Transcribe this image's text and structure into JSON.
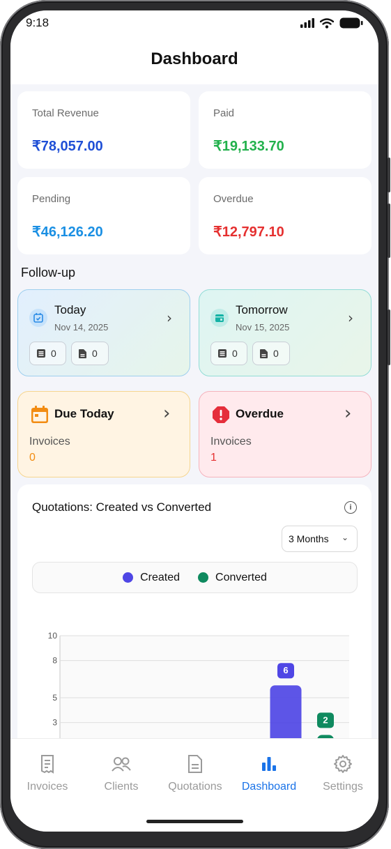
{
  "status_bar": {
    "time": "9:18"
  },
  "header": {
    "title": "Dashboard"
  },
  "stats": [
    {
      "label": "Total Revenue",
      "value": "₹78,057.00",
      "color": "#1f4fd6"
    },
    {
      "label": "Paid",
      "value": "₹19,133.70",
      "color": "#22b14c"
    },
    {
      "label": "Pending",
      "value": "₹46,126.20",
      "color": "#1a8fe3"
    },
    {
      "label": "Overdue",
      "value": "₹12,797.10",
      "color": "#e53030"
    }
  ],
  "followup": {
    "section_title": "Follow-up",
    "today": {
      "title": "Today",
      "date": "Nov 14, 2025",
      "invoices_count": "0",
      "quotations_count": "0"
    },
    "tomorrow": {
      "title": "Tomorrow",
      "date": "Nov 15, 2025",
      "invoices_count": "0",
      "quotations_count": "0"
    },
    "due_today": {
      "title": "Due Today",
      "label": "Invoices",
      "value": "0"
    },
    "overdue": {
      "title": "Overdue",
      "label": "Invoices",
      "value": "1"
    }
  },
  "quotations_chart": {
    "title": "Quotations: Created vs Converted",
    "range": "3 Months",
    "legend": [
      {
        "name": "Created",
        "color": "#4f46e5"
      },
      {
        "name": "Converted",
        "color": "#0f8a5f"
      }
    ]
  },
  "chart_data": {
    "type": "bar",
    "title": "Quotations: Created vs Converted",
    "ylim": [
      0,
      10
    ],
    "y_ticks": [
      "10",
      "8",
      "5",
      "3"
    ],
    "series": [
      {
        "name": "Created",
        "values": [
          6
        ]
      },
      {
        "name": "Converted",
        "values": [
          2
        ]
      }
    ],
    "data_labels": [
      "6",
      "2"
    ],
    "grid": true
  },
  "bottom_nav": {
    "items": [
      {
        "label": "Invoices",
        "icon": "invoice-icon",
        "active": false
      },
      {
        "label": "Clients",
        "icon": "clients-icon",
        "active": false
      },
      {
        "label": "Quotations",
        "icon": "document-icon",
        "active": false
      },
      {
        "label": "Dashboard",
        "icon": "bar-chart-icon",
        "active": true
      },
      {
        "label": "Settings",
        "icon": "gear-icon",
        "active": false
      }
    ],
    "active_color": "#1a73e8",
    "inactive_color": "#9a9a9a"
  }
}
